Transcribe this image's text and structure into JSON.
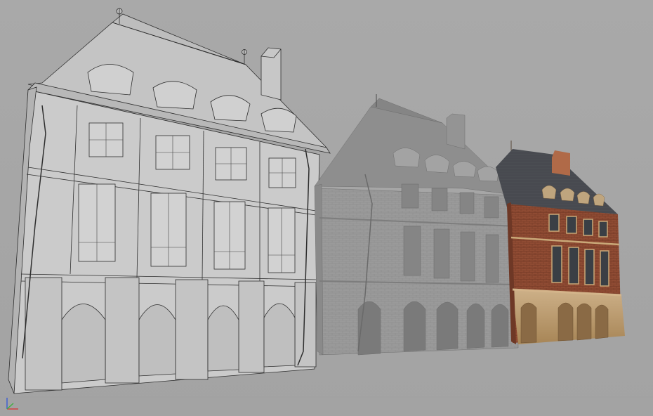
{
  "viewport": {
    "background_color": "#a7a7a7",
    "view": "perspective"
  },
  "models": [
    {
      "id": "building-wireframe",
      "shading": "wireframe-on-shaded",
      "color": "#c8c8c8"
    },
    {
      "id": "building-clay",
      "shading": "shaded-grey",
      "color": "#9c9c9c"
    },
    {
      "id": "building-textured",
      "shading": "textured",
      "colors": {
        "brick": "#8e4a32",
        "stone": "#c9a878",
        "roof": "#4a4d52"
      }
    }
  ],
  "axis_gizmo": {
    "icon": "axis-gizmo-icon",
    "colors": {
      "x": "#d04040",
      "y": "#40b040",
      "z": "#4060d0"
    }
  }
}
